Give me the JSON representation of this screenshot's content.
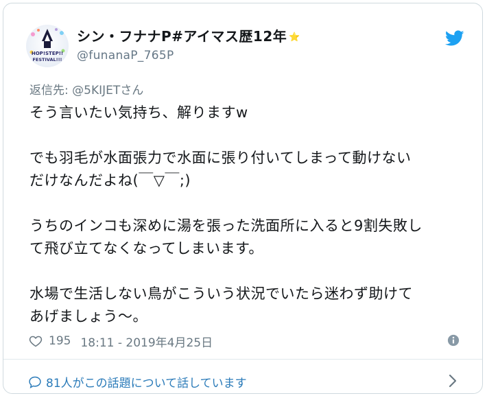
{
  "author": {
    "display_name": "シン・フナナP#アイマス歴12年",
    "badge": "⭐",
    "handle": "@funanaP_765P",
    "avatar_text": [
      "HOP!STEP!!",
      "FESTIVAL!!!"
    ]
  },
  "tweet": {
    "reply_label": "返信先: ",
    "reply_mention": "@5KIJETさん",
    "paragraphs": [
      "そう言いたい気持ち、解りますw",
      "でも羽毛が水面張力で水面に張り付いてしまって動けない\nだけなんだよね(￣▽￣;)",
      "うちのインコも深めに湯を張った洗面所に入ると9割失敗し\nて飛び立てなくなってしまいます。",
      "水場で生活しない鳥がこういう状況でいたら迷わず助けて\nあげましょう〜。"
    ],
    "likes": "195",
    "timestamp": "18:11 - 2019年4月25日"
  },
  "footer": {
    "conversation_label": "81人がこの話題について話しています"
  },
  "colors": {
    "twitter_blue": "#1da1f2",
    "link": "#2b7bb9",
    "muted": "#697882",
    "text": "#14171a"
  },
  "icons": [
    "twitter-bird-icon",
    "heart-icon",
    "info-icon",
    "speech-bubble-icon",
    "chevron-right-icon"
  ]
}
